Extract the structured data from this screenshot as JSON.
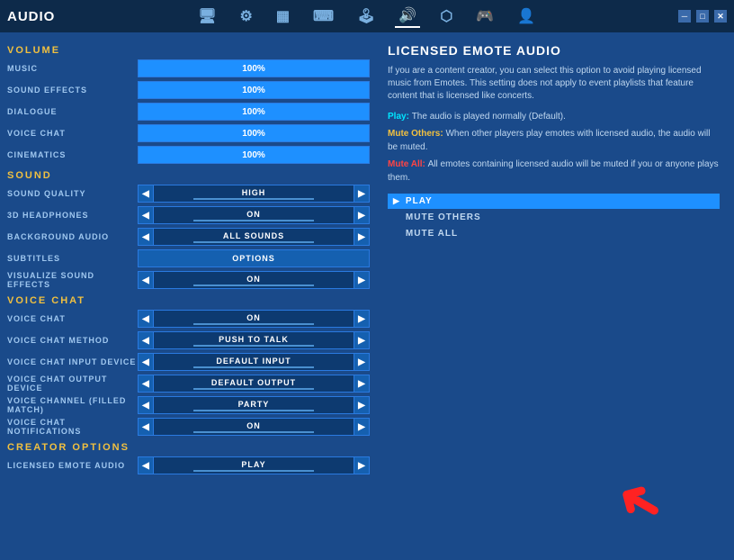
{
  "titleBar": {
    "title": "Audio",
    "controls": [
      "─",
      "□",
      "✕"
    ]
  },
  "navIcons": [
    {
      "name": "monitor-icon",
      "symbol": "🖥",
      "active": false
    },
    {
      "name": "gear-icon",
      "symbol": "⚙",
      "active": false
    },
    {
      "name": "display-icon",
      "symbol": "▦",
      "active": false
    },
    {
      "name": "keyboard-icon",
      "symbol": "⌨",
      "active": false
    },
    {
      "name": "controller-alt-icon",
      "symbol": "🕹",
      "active": false
    },
    {
      "name": "audio-icon",
      "symbol": "🔊",
      "active": true
    },
    {
      "name": "network-icon",
      "symbol": "⬡",
      "active": false
    },
    {
      "name": "gamepad-icon",
      "symbol": "🎮",
      "active": false
    },
    {
      "name": "user-icon",
      "symbol": "👤",
      "active": false
    }
  ],
  "sections": {
    "volume": {
      "header": "VOLUME",
      "rows": [
        {
          "label": "MUSIC",
          "value": "100%",
          "type": "volume"
        },
        {
          "label": "SOUND EFFECTS",
          "value": "100%",
          "type": "volume"
        },
        {
          "label": "DIALOGUE",
          "value": "100%",
          "type": "volume"
        },
        {
          "label": "VOICE CHAT",
          "value": "100%",
          "type": "volume"
        },
        {
          "label": "CINEMATICS",
          "value": "100%",
          "type": "volume"
        }
      ]
    },
    "sound": {
      "header": "SOUND",
      "rows": [
        {
          "label": "SOUND QUALITY",
          "value": "HIGH",
          "type": "selector"
        },
        {
          "label": "3D HEADPHONES",
          "value": "ON",
          "type": "selector"
        },
        {
          "label": "BACKGROUND AUDIO",
          "value": "ALL SOUNDS",
          "type": "selector"
        },
        {
          "label": "SUBTITLES",
          "value": "OPTIONS",
          "type": "options"
        },
        {
          "label": "VISUALIZE SOUND EFFECTS",
          "value": "ON",
          "type": "selector"
        }
      ]
    },
    "voiceChat": {
      "header": "VOICE CHAT",
      "rows": [
        {
          "label": "VOICE CHAT",
          "value": "ON",
          "type": "selector"
        },
        {
          "label": "VOICE CHAT METHOD",
          "value": "PUSH TO TALK",
          "type": "selector"
        },
        {
          "label": "VOICE CHAT INPUT DEVICE",
          "value": "DEFAULT INPUT",
          "type": "selector"
        },
        {
          "label": "VOICE CHAT OUTPUT DEVICE",
          "value": "DEFAULT OUTPUT",
          "type": "selector"
        },
        {
          "label": "VOICE CHANNEL (FILLED MATCH)",
          "value": "PARTY",
          "type": "selector"
        },
        {
          "label": "VOICE CHAT NOTIFICATIONS",
          "value": "ON",
          "type": "selector"
        }
      ]
    },
    "creatorOptions": {
      "header": "CREATOR OPTIONS",
      "rows": [
        {
          "label": "LICENSED EMOTE AUDIO",
          "value": "PLAY",
          "type": "selector"
        }
      ]
    }
  },
  "rightPanel": {
    "title": "LICENSED EMOTE AUDIO",
    "desc": "If you are a content creator, you can select this option to avoid playing licensed music from Emotes. This setting does not apply to event playlists that feature content that is licensed like concerts.",
    "playLine": {
      "label": "Play:",
      "text": "The audio is played normally (Default)."
    },
    "muteOthersLine": {
      "label": "Mute Others:",
      "text": "When other players play emotes with licensed audio, the audio will be muted."
    },
    "muteAllLine": {
      "label": "Mute All:",
      "text": "All emotes containing licensed audio will be muted if you or anyone plays them."
    },
    "choices": [
      {
        "value": "PLAY",
        "selected": true
      },
      {
        "value": "MUTE OTHERS",
        "selected": false
      },
      {
        "value": "MUTE ALL",
        "selected": false
      }
    ]
  }
}
